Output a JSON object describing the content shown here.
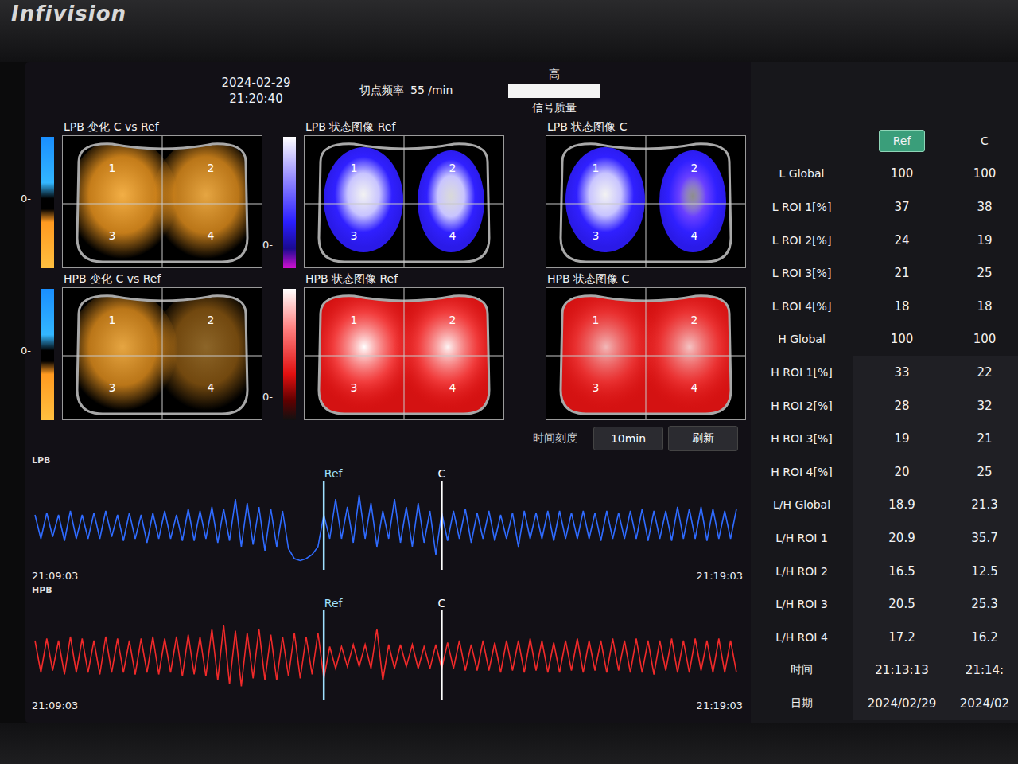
{
  "brand": "Infivision",
  "header": {
    "date": "2024-02-29",
    "time": "21:20:40",
    "rate_label": "切点频率",
    "rate_value": "55 /min",
    "quality_value": "高",
    "quality_label": "信号质量",
    "quality_level": 1
  },
  "images": [
    {
      "title": "LPB 变化 C vs Ref",
      "kind": "change",
      "scale": "0-",
      "lungs": [
        0.95,
        0.9
      ],
      "quadrants": [
        "1",
        "2",
        "3",
        "4"
      ]
    },
    {
      "title": "LPB 状态图像 Ref",
      "kind": "lpb-status",
      "scale": "0-",
      "lungs": [
        0.95,
        0.85
      ],
      "quadrants": [
        "1",
        "2",
        "3",
        "4"
      ]
    },
    {
      "title": "LPB 状态图像 C",
      "kind": "lpb-status",
      "scale": "",
      "lungs": [
        0.95,
        0.55
      ],
      "quadrants": [
        "1",
        "2",
        "3",
        "4"
      ]
    },
    {
      "title": "HPB 变化 C vs Ref",
      "kind": "change",
      "scale": "0-",
      "lungs": [
        0.9,
        0.55
      ],
      "quadrants": [
        "1",
        "2",
        "3",
        "4"
      ]
    },
    {
      "title": "HPB 状态图像 Ref",
      "kind": "hpb-status",
      "scale": "0-",
      "lungs": [
        1,
        0.95
      ],
      "quadrants": [
        "1",
        "2",
        "3",
        "4"
      ]
    },
    {
      "title": "HPB 状态图像 C",
      "kind": "hpb-status",
      "scale": "",
      "lungs": [
        0.7,
        0.75
      ],
      "quadrants": [
        "1",
        "2",
        "3",
        "4"
      ]
    }
  ],
  "controls": {
    "label": "时间刻度",
    "buttons": [
      {
        "label": "10min",
        "selected": false
      },
      {
        "label": "刷新",
        "selected": false
      }
    ]
  },
  "waveforms": [
    {
      "name": "LPB",
      "color": "#2f6bff",
      "start": "21:09:03",
      "end": "21:19:03",
      "markers": [
        {
          "label": "Ref",
          "index": 49,
          "color": "#9fe0ff"
        },
        {
          "label": "C",
          "index": 69,
          "color": "#ffffff"
        }
      ],
      "values": [
        0.3,
        -0.3,
        0.35,
        -0.25,
        0.3,
        -0.35,
        0.4,
        -0.3,
        0.3,
        -0.3,
        0.35,
        -0.3,
        0.4,
        -0.25,
        0.3,
        -0.35,
        0.35,
        -0.3,
        0.3,
        -0.4,
        0.35,
        -0.3,
        0.4,
        -0.3,
        0.3,
        -0.35,
        0.45,
        -0.35,
        0.4,
        -0.3,
        0.5,
        -0.4,
        0.45,
        -0.35,
        0.7,
        -0.5,
        0.6,
        -0.45,
        0.5,
        -0.6,
        0.45,
        -0.5,
        0.4,
        -0.55,
        -0.8,
        -0.85,
        -0.8,
        -0.7,
        -0.5,
        0.3,
        -0.3,
        0.7,
        -0.3,
        0.5,
        -0.4,
        0.8,
        -0.3,
        0.6,
        -0.5,
        0.4,
        -0.3,
        0.7,
        -0.4,
        0.5,
        -0.5,
        0.6,
        -0.4,
        0.4,
        -0.7,
        0.35,
        -0.35,
        0.4,
        -0.3,
        0.45,
        -0.4,
        0.35,
        -0.3,
        0.4,
        -0.35,
        0.3,
        -0.3,
        0.35,
        -0.5,
        0.4,
        -0.3,
        0.35,
        -0.3,
        0.4,
        -0.35,
        0.4,
        -0.3,
        0.35,
        -0.3,
        0.4,
        -0.3,
        0.35,
        -0.35,
        0.4,
        -0.3,
        0.35,
        -0.3,
        0.4,
        -0.3,
        0.45,
        -0.35,
        0.4,
        -0.3,
        0.4,
        -0.35,
        0.5,
        -0.3,
        0.45,
        -0.3,
        0.5,
        -0.35,
        0.45,
        -0.3,
        0.4,
        -0.3,
        0.45
      ]
    },
    {
      "name": "HPB",
      "color": "#f02a2a",
      "start": "21:09:03",
      "end": "21:19:03",
      "markers": [
        {
          "label": "Ref",
          "index": 49,
          "color": "#9fe0ff"
        },
        {
          "label": "C",
          "index": 69,
          "color": "#ffffff"
        }
      ],
      "values": [
        0.4,
        -0.4,
        0.45,
        -0.35,
        0.4,
        -0.45,
        0.5,
        -0.4,
        0.45,
        -0.4,
        0.4,
        -0.45,
        0.5,
        -0.4,
        0.45,
        -0.4,
        0.4,
        -0.45,
        0.45,
        -0.4,
        0.5,
        -0.45,
        0.45,
        -0.4,
        0.5,
        -0.5,
        0.55,
        -0.45,
        0.5,
        -0.5,
        0.7,
        -0.6,
        0.8,
        -0.7,
        0.65,
        -0.75,
        0.6,
        -0.55,
        0.7,
        -0.6,
        0.55,
        -0.6,
        0.5,
        -0.5,
        0.6,
        -0.55,
        0.5,
        -0.45,
        0.6,
        -0.55,
        0.25,
        -0.3,
        0.25,
        -0.25,
        0.3,
        -0.25,
        0.3,
        -0.3,
        0.7,
        -0.6,
        0.3,
        -0.3,
        0.3,
        -0.25,
        0.3,
        -0.3,
        0.25,
        -0.3,
        0.3,
        -0.3,
        0.35,
        -0.3,
        0.4,
        -0.35,
        0.3,
        -0.35,
        0.4,
        -0.35,
        0.35,
        -0.4,
        0.4,
        -0.35,
        0.4,
        -0.4,
        0.45,
        -0.35,
        0.4,
        -0.4,
        0.35,
        -0.4,
        0.4,
        -0.35,
        0.45,
        -0.4,
        0.4,
        -0.35,
        0.4,
        -0.4,
        0.45,
        -0.35,
        0.4,
        -0.4,
        0.45,
        -0.4,
        0.4,
        -0.45,
        0.4,
        -0.35,
        0.45,
        -0.4,
        0.4,
        -0.4,
        0.45,
        -0.35,
        0.4,
        -0.4,
        0.45,
        -0.4,
        0.4,
        -0.4
      ]
    }
  ],
  "table": {
    "columns": [
      {
        "label": "Ref",
        "selected": true
      },
      {
        "label": "C",
        "selected": false
      }
    ],
    "rows": [
      {
        "label": "L Global",
        "values": [
          "100",
          "100"
        ]
      },
      {
        "label": "L ROI 1[%]",
        "values": [
          "37",
          "38"
        ]
      },
      {
        "label": "L ROI 2[%]",
        "values": [
          "24",
          "19"
        ]
      },
      {
        "label": "L ROI 3[%]",
        "values": [
          "21",
          "25"
        ]
      },
      {
        "label": "L ROI 4[%]",
        "values": [
          "18",
          "18"
        ]
      },
      {
        "label": "H Global",
        "values": [
          "100",
          "100"
        ]
      },
      {
        "label": "H ROI 1[%]",
        "values": [
          "33",
          "22"
        ]
      },
      {
        "label": "H ROI 2[%]",
        "values": [
          "28",
          "32"
        ]
      },
      {
        "label": "H ROI 3[%]",
        "values": [
          "19",
          "21"
        ]
      },
      {
        "label": "H ROI 4[%]",
        "values": [
          "20",
          "25"
        ]
      },
      {
        "label": "L/H Global",
        "values": [
          "18.9",
          "21.3"
        ]
      },
      {
        "label": "L/H ROI 1",
        "values": [
          "20.9",
          "35.7"
        ]
      },
      {
        "label": "L/H ROI 2",
        "values": [
          "16.5",
          "12.5"
        ]
      },
      {
        "label": "L/H ROI 3",
        "values": [
          "20.5",
          "25.3"
        ]
      },
      {
        "label": "L/H ROI 4",
        "values": [
          "17.2",
          "16.2"
        ]
      },
      {
        "label": "时间",
        "values": [
          "21:13:13",
          "21:14:"
        ]
      },
      {
        "label": "日期",
        "values": [
          "2024/02/29",
          "2024/02"
        ]
      }
    ]
  }
}
